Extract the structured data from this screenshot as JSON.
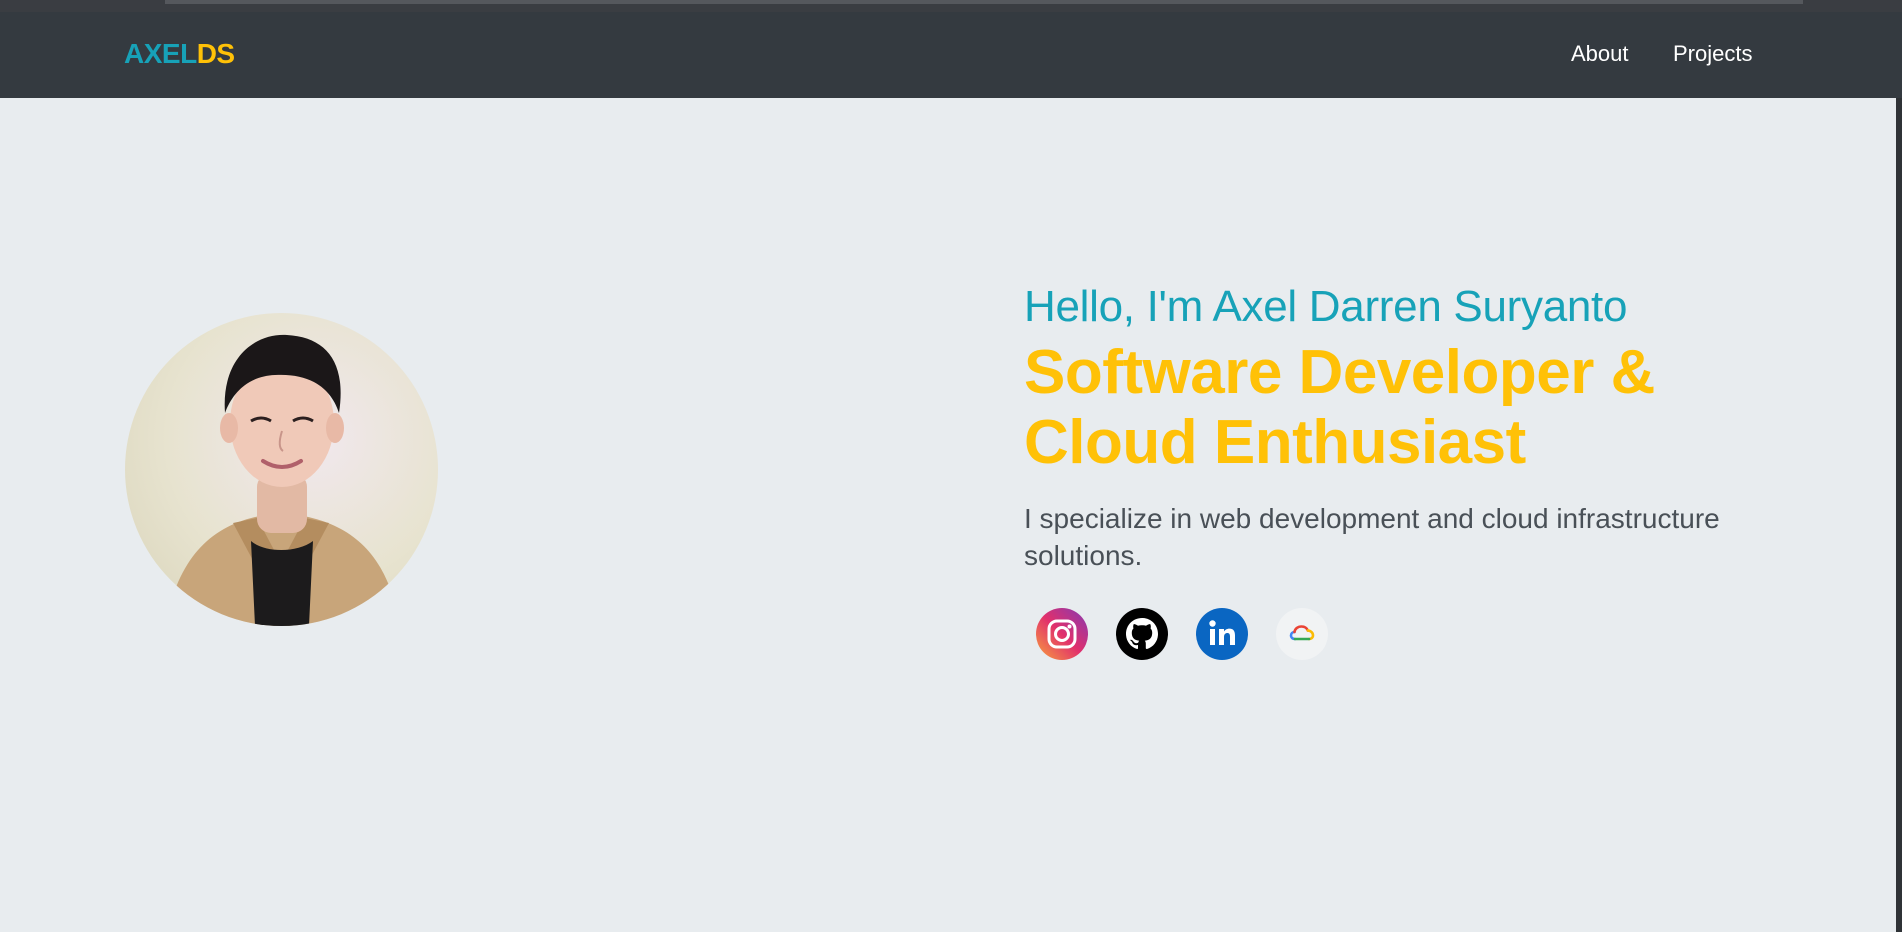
{
  "brand": {
    "part1": "AXEL",
    "part2": "DS"
  },
  "nav": {
    "about": "About",
    "projects": "Projects"
  },
  "hero": {
    "greeting": "Hello, I'm Axel Darren Suryanto",
    "headline": "Software Developer & Cloud Enthusiast",
    "bio": "I specialize in web development and cloud infrastructure solutions."
  },
  "socials": [
    {
      "name": "instagram-icon"
    },
    {
      "name": "github-icon"
    },
    {
      "name": "linkedin-icon"
    },
    {
      "name": "google-cloud-icon"
    }
  ],
  "colors": {
    "accent_teal": "#17a2b8",
    "accent_yellow": "#ffc107",
    "navbar": "#343a40",
    "background": "#e8ecef",
    "text_muted": "#495057"
  }
}
